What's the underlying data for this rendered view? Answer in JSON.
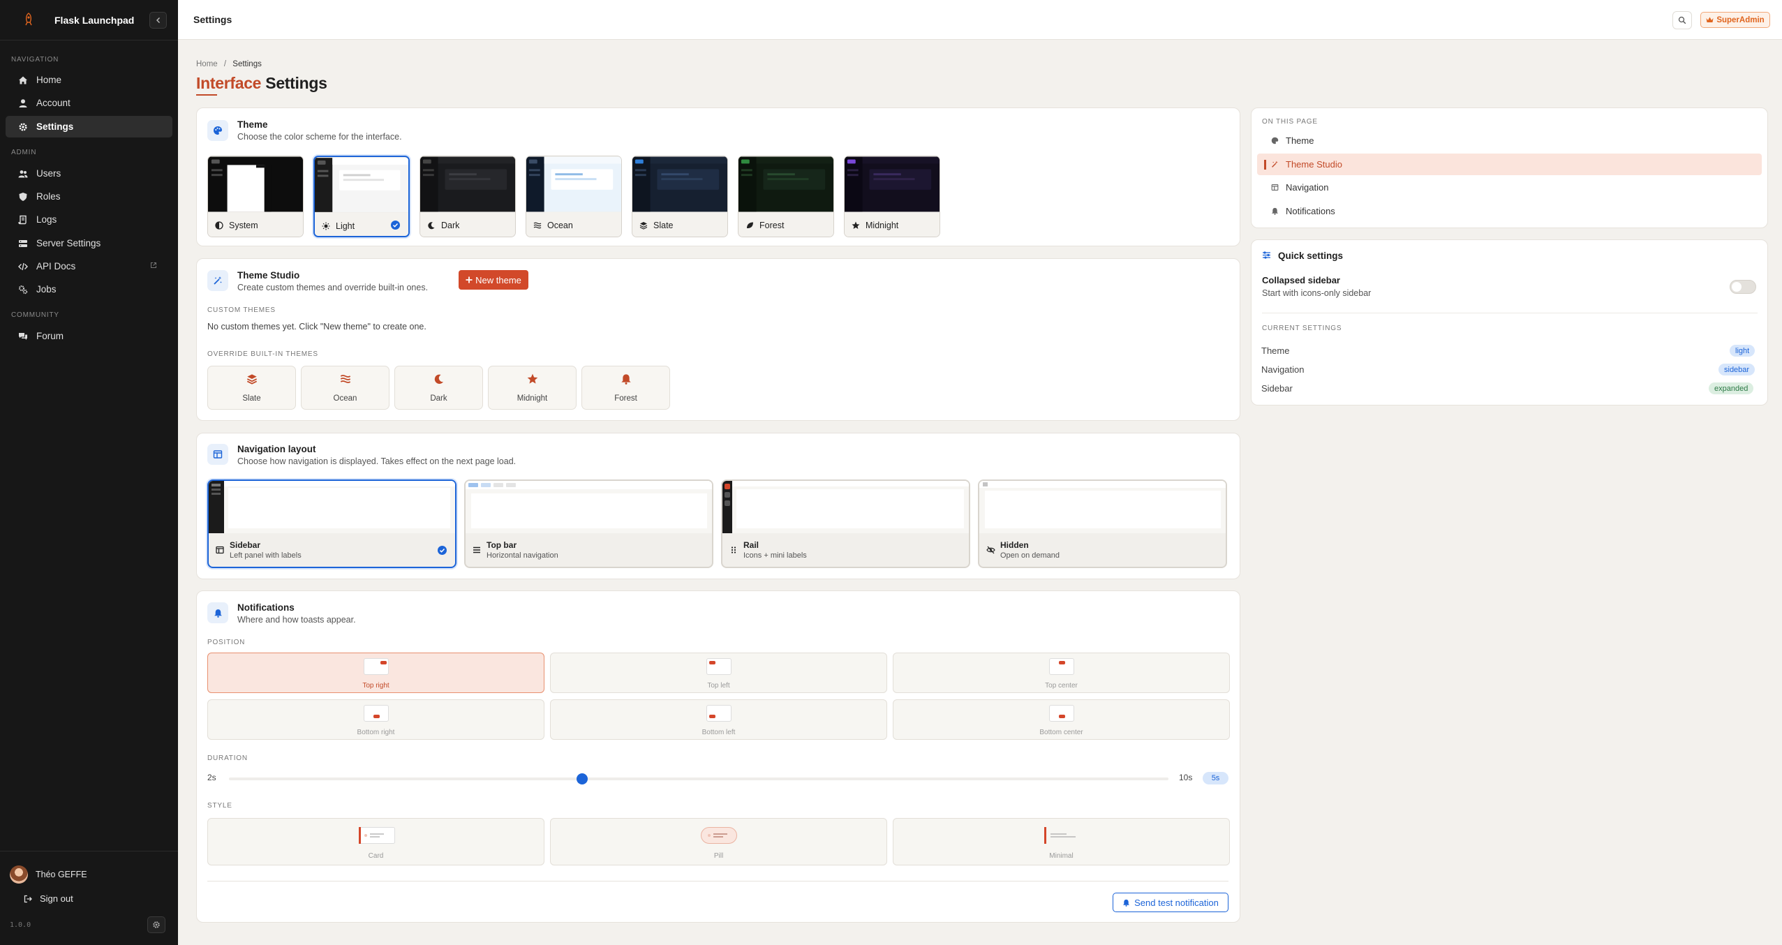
{
  "app": {
    "name": "Flask Launchpad",
    "version": "1.0.0"
  },
  "sidebar": {
    "sections": {
      "navigation": "NAVIGATION",
      "admin": "ADMIN",
      "community": "COMMUNITY"
    },
    "items": [
      {
        "label": "Home"
      },
      {
        "label": "Account"
      },
      {
        "label": "Settings"
      },
      {
        "label": "Users"
      },
      {
        "label": "Roles"
      },
      {
        "label": "Logs"
      },
      {
        "label": "Server Settings"
      },
      {
        "label": "API Docs"
      },
      {
        "label": "Jobs"
      },
      {
        "label": "Forum"
      }
    ],
    "user": {
      "name": "Théo GEFFE"
    },
    "signout": "Sign out"
  },
  "topbar": {
    "title": "Settings",
    "role": "SuperAdmin"
  },
  "breadcrumb": {
    "home": "Home",
    "sep": "/",
    "current": "Settings"
  },
  "page": {
    "title_accent": "Interface",
    "title_rest": " Settings"
  },
  "theme": {
    "title": "Theme",
    "subtitle": "Choose the color scheme for the interface.",
    "options": [
      {
        "label": "System"
      },
      {
        "label": "Light"
      },
      {
        "label": "Dark"
      },
      {
        "label": "Ocean"
      },
      {
        "label": "Slate"
      },
      {
        "label": "Forest"
      },
      {
        "label": "Midnight"
      }
    ],
    "selected": "Light"
  },
  "studio": {
    "title": "Theme Studio",
    "subtitle": "Create custom themes and override built-in ones.",
    "new_button": "New theme",
    "custom_label": "CUSTOM THEMES",
    "empty_text": "No custom themes yet. Click \"New theme\" to create one.",
    "override_label": "OVERRIDE BUILT-IN THEMES",
    "overrides": [
      {
        "label": "Slate"
      },
      {
        "label": "Ocean"
      },
      {
        "label": "Dark"
      },
      {
        "label": "Midnight"
      },
      {
        "label": "Forest"
      }
    ]
  },
  "navlayout": {
    "title": "Navigation layout",
    "subtitle": "Choose how navigation is displayed. Takes effect on the next page load.",
    "options": [
      {
        "title": "Sidebar",
        "sub": "Left panel with labels"
      },
      {
        "title": "Top bar",
        "sub": "Horizontal navigation"
      },
      {
        "title": "Rail",
        "sub": "Icons + mini labels"
      },
      {
        "title": "Hidden",
        "sub": "Open on demand"
      }
    ],
    "selected": "Sidebar"
  },
  "notifications": {
    "title": "Notifications",
    "subtitle": "Where and how toasts appear.",
    "position_label": "POSITION",
    "positions": [
      {
        "label": "Top right"
      },
      {
        "label": "Top left"
      },
      {
        "label": "Top center"
      },
      {
        "label": "Bottom right"
      },
      {
        "label": "Bottom left"
      },
      {
        "label": "Bottom center"
      }
    ],
    "selected_position": "Top right",
    "duration_label": "DURATION",
    "duration_min": "2s",
    "duration_max": "10s",
    "duration_value": "5s",
    "style_label": "STYLE",
    "styles": [
      {
        "label": "Card"
      },
      {
        "label": "Pill"
      },
      {
        "label": "Minimal"
      }
    ],
    "test_button": "Send test notification"
  },
  "toc": {
    "label": "ON THIS PAGE",
    "items": [
      {
        "label": "Theme"
      },
      {
        "label": "Theme Studio"
      },
      {
        "label": "Navigation"
      },
      {
        "label": "Notifications"
      }
    ],
    "active": "Theme Studio"
  },
  "quick": {
    "title": "Quick settings",
    "collapsed_title": "Collapsed sidebar",
    "collapsed_sub": "Start with icons-only sidebar",
    "collapsed_on": false,
    "current_label": "CURRENT SETTINGS",
    "current": [
      {
        "key": "Theme",
        "value": "light"
      },
      {
        "key": "Navigation",
        "value": "sidebar"
      },
      {
        "key": "Sidebar",
        "value": "expanded"
      }
    ]
  },
  "colors": {
    "accent": "#c24a28",
    "primary": "#1c64d8",
    "sidebar_bg": "#171717",
    "page_bg": "#f3f1ed"
  }
}
